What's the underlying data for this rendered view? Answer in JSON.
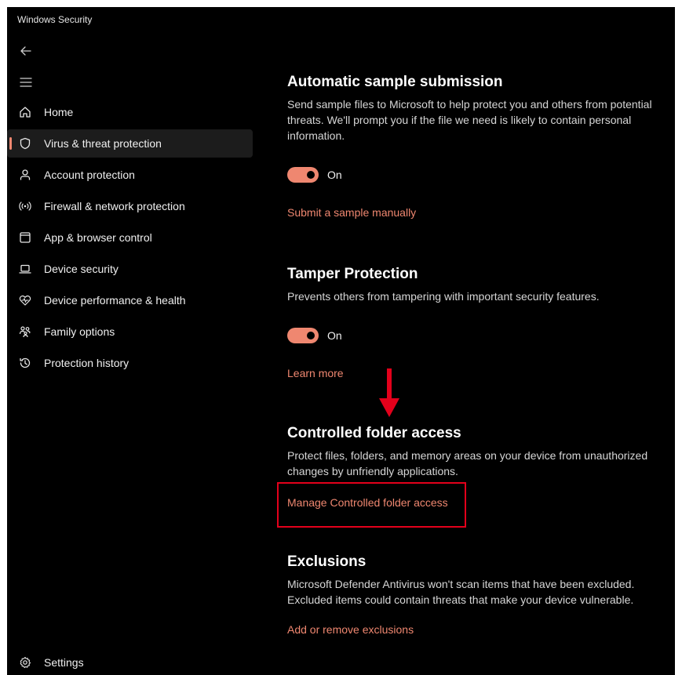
{
  "window": {
    "title": "Windows Security"
  },
  "nav": {
    "items": [
      {
        "label": "Home",
        "icon": "home-icon"
      },
      {
        "label": "Virus & threat protection",
        "icon": "shield-icon",
        "selected": true
      },
      {
        "label": "Account protection",
        "icon": "person-icon"
      },
      {
        "label": "Firewall & network protection",
        "icon": "wifi-antenna-icon"
      },
      {
        "label": "App & browser control",
        "icon": "browser-window-icon"
      },
      {
        "label": "Device security",
        "icon": "laptop-icon"
      },
      {
        "label": "Device performance & health",
        "icon": "heart-pulse-icon"
      },
      {
        "label": "Family options",
        "icon": "family-icon"
      },
      {
        "label": "Protection history",
        "icon": "history-icon"
      }
    ],
    "settings_label": "Settings",
    "settings_icon": "gear-icon"
  },
  "sections": {
    "sample": {
      "title": "Automatic sample submission",
      "description": "Send sample files to Microsoft to help protect you and others from potential threats. We'll prompt you if the file we need is likely to contain personal information.",
      "toggle_label": "On",
      "link": "Submit a sample manually"
    },
    "tamper": {
      "title": "Tamper Protection",
      "description": "Prevents others from tampering with important security features.",
      "toggle_label": "On",
      "link": "Learn more"
    },
    "cfa": {
      "title": "Controlled folder access",
      "description": "Protect files, folders, and memory areas on your device from unauthorized changes by unfriendly applications.",
      "link": "Manage Controlled folder access"
    },
    "exclusions": {
      "title": "Exclusions",
      "description": "Microsoft Defender Antivirus won't scan items that have been excluded. Excluded items could contain threats that make your device vulnerable.",
      "link": "Add or remove exclusions"
    }
  },
  "colors": {
    "accent": "#ef8770",
    "highlight_annotation": "#e3001b",
    "background": "#000000"
  }
}
